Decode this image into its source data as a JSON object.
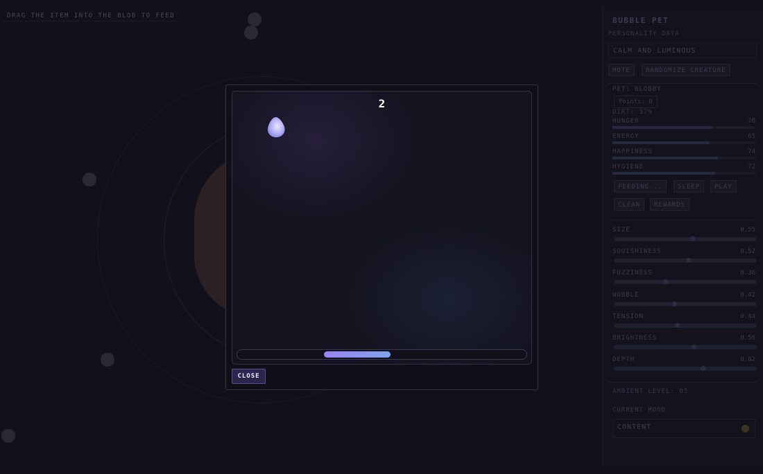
{
  "hint": "DRAG THE ITEM INTO THE BLOB TO FEED",
  "panel": {
    "title": "BUBBLE PET",
    "subtitle": "PERSONALITY DATA",
    "personality": "CALM AND LUMINOUS",
    "mute_label": "MUTE",
    "randomize_label": "RANDOMIZE CREATURE",
    "pet_name": "PET: BLOBBY",
    "points": "Points: 0",
    "dirt": "DIRT: 57%",
    "stats": [
      {
        "label": "HUNGER",
        "value": "70",
        "fraction": 0.7
      },
      {
        "label": "ENERGY",
        "value": "65",
        "fraction": 0.68
      },
      {
        "label": "HAPPINESS",
        "value": "74",
        "fraction": 0.74
      },
      {
        "label": "HYGIENE",
        "value": "72",
        "fraction": 0.72
      }
    ],
    "actions": {
      "feeding": "FEEDING...",
      "sleep": "SLEEP",
      "play": "PLAY",
      "clean": "CLEAN",
      "rewards": "REWARDS"
    },
    "sliders": [
      {
        "label": "SIZE",
        "value": "0.55",
        "fraction": 0.55
      },
      {
        "label": "SQUISHINESS",
        "value": "0.52",
        "fraction": 0.52
      },
      {
        "label": "FUZZINESS",
        "value": "0.36",
        "fraction": 0.36
      },
      {
        "label": "WOBBLE",
        "value": "0.42",
        "fraction": 0.42
      },
      {
        "label": "TENSION",
        "value": "0.44",
        "fraction": 0.44
      },
      {
        "label": "BRIGHTNESS",
        "value": "0.56",
        "fraction": 0.56
      },
      {
        "label": "DEPTH",
        "value": "0.62",
        "fraction": 0.62
      }
    ],
    "ambient": "AMBIENT LEVEL: 05",
    "mood_label": "CURRENT MOOD",
    "mood": "CONTENT",
    "mood_color": "#3d3424"
  },
  "modal": {
    "score": "2",
    "food_icon": "food-blob-icon",
    "progress": {
      "start": 0.3,
      "end": 0.53
    },
    "close_label": "CLOSE",
    "accent": "#9b82f2"
  }
}
